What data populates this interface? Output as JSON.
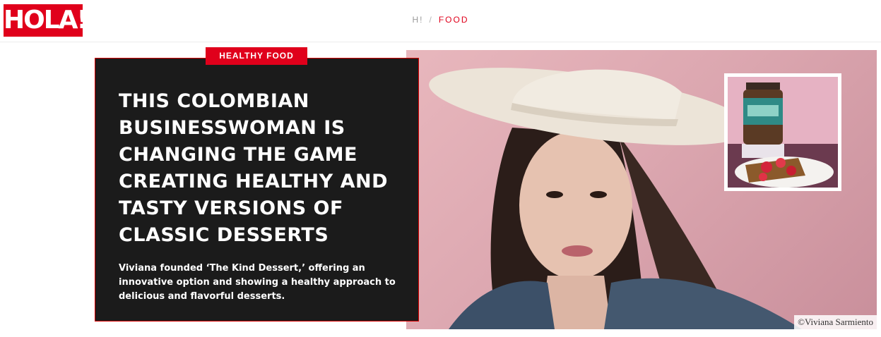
{
  "header": {
    "logo": "HOLA!",
    "breadcrumb": {
      "home": "H!",
      "separator": "/",
      "current": "FOOD"
    }
  },
  "article": {
    "category": "HEALTHY FOOD",
    "headline": "THIS COLOMBIAN BUSINESSWOMAN IS CHANGING THE GAME CREATING HEALTHY AND TASTY VERSIONS OF CLASSIC DESSERTS",
    "dek": "Viviana founded ‘The Kind Dessert,’ offering an innovative option and showing a healthy approach to delicious and flavorful desserts.",
    "photo_credit": "©Viviana Sarmiento"
  },
  "colors": {
    "brand": "#e0001b",
    "card": "#1b1b1b",
    "text": "#ffffff"
  }
}
